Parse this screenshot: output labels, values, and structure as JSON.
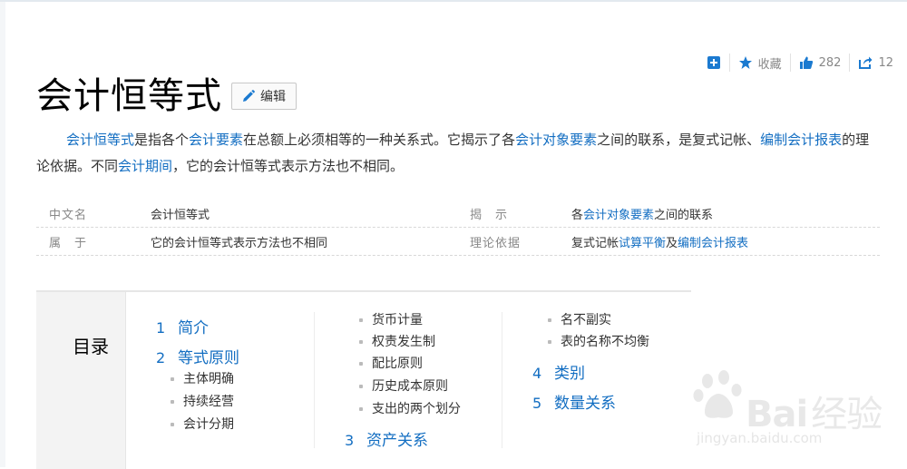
{
  "toolbar": {
    "add_icon": "plus-square-icon",
    "fav_label": "收藏",
    "like_count": "282",
    "share_count": "12"
  },
  "title": "会计恒等式",
  "edit_label": "编辑",
  "summary": {
    "p1": "会计恒等式",
    "p2": "是指各个",
    "p3": "会计要素",
    "p4": "在总额上必须相等的一种关系式。它揭示了各",
    "p5": "会计对象要素",
    "p6": "之间的联系，是复式记帐、",
    "p7": "编制会计报表",
    "p8": "的理论依据。不同",
    "p9": "会计期间",
    "p10": "，它的会计恒等式表示方法也不相同。"
  },
  "info": {
    "row1": {
      "k1": "中文名",
      "v1": "会计恒等式",
      "k2": "揭　示",
      "v2a": "各",
      "v2b": "会计对象要素",
      "v2c": "之间的联系"
    },
    "row2": {
      "k1": "属　于",
      "v1": "它的会计恒等式表示方法也不相同",
      "k2": "理论依据",
      "v2a": "复式记帐",
      "v2b": "试算平衡",
      "v2c": "及",
      "v2d": "编制会计报表"
    }
  },
  "catalog": {
    "label": "目录",
    "col1": {
      "s1_num": "1",
      "s1": "简介",
      "s2_num": "2",
      "s2": "等式原则",
      "sub": [
        "主体明确",
        "持续经营",
        "会计分期"
      ]
    },
    "col2": {
      "sub": [
        "货币计量",
        "权责发生制",
        "配比原则",
        "历史成本原则",
        "支出的两个划分"
      ],
      "s3_num": "3",
      "s3": "资产关系"
    },
    "col3": {
      "sub": [
        "名不副实",
        "表的名称不均衡"
      ],
      "s4_num": "4",
      "s4": "类别",
      "s5_num": "5",
      "s5": "数量关系"
    }
  },
  "watermark": {
    "text": "Bai",
    "text2": "经验",
    "url": "jingyan.baidu.com"
  },
  "colors": {
    "link": "#136ec2",
    "icon": "#1b7ad0"
  }
}
